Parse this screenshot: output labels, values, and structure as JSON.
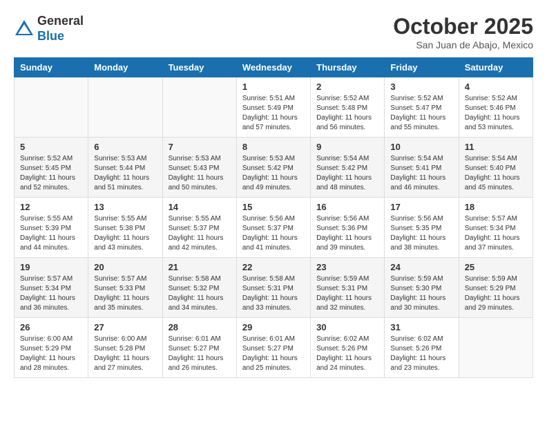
{
  "header": {
    "logo_general": "General",
    "logo_blue": "Blue",
    "month_title": "October 2025",
    "location": "San Juan de Abajo, Mexico"
  },
  "days_of_week": [
    "Sunday",
    "Monday",
    "Tuesday",
    "Wednesday",
    "Thursday",
    "Friday",
    "Saturday"
  ],
  "weeks": [
    [
      {
        "day": "",
        "sunrise": "",
        "sunset": "",
        "daylight": ""
      },
      {
        "day": "",
        "sunrise": "",
        "sunset": "",
        "daylight": ""
      },
      {
        "day": "",
        "sunrise": "",
        "sunset": "",
        "daylight": ""
      },
      {
        "day": "1",
        "sunrise": "Sunrise: 5:51 AM",
        "sunset": "Sunset: 5:49 PM",
        "daylight": "Daylight: 11 hours and 57 minutes."
      },
      {
        "day": "2",
        "sunrise": "Sunrise: 5:52 AM",
        "sunset": "Sunset: 5:48 PM",
        "daylight": "Daylight: 11 hours and 56 minutes."
      },
      {
        "day": "3",
        "sunrise": "Sunrise: 5:52 AM",
        "sunset": "Sunset: 5:47 PM",
        "daylight": "Daylight: 11 hours and 55 minutes."
      },
      {
        "day": "4",
        "sunrise": "Sunrise: 5:52 AM",
        "sunset": "Sunset: 5:46 PM",
        "daylight": "Daylight: 11 hours and 53 minutes."
      }
    ],
    [
      {
        "day": "5",
        "sunrise": "Sunrise: 5:52 AM",
        "sunset": "Sunset: 5:45 PM",
        "daylight": "Daylight: 11 hours and 52 minutes."
      },
      {
        "day": "6",
        "sunrise": "Sunrise: 5:53 AM",
        "sunset": "Sunset: 5:44 PM",
        "daylight": "Daylight: 11 hours and 51 minutes."
      },
      {
        "day": "7",
        "sunrise": "Sunrise: 5:53 AM",
        "sunset": "Sunset: 5:43 PM",
        "daylight": "Daylight: 11 hours and 50 minutes."
      },
      {
        "day": "8",
        "sunrise": "Sunrise: 5:53 AM",
        "sunset": "Sunset: 5:42 PM",
        "daylight": "Daylight: 11 hours and 49 minutes."
      },
      {
        "day": "9",
        "sunrise": "Sunrise: 5:54 AM",
        "sunset": "Sunset: 5:42 PM",
        "daylight": "Daylight: 11 hours and 48 minutes."
      },
      {
        "day": "10",
        "sunrise": "Sunrise: 5:54 AM",
        "sunset": "Sunset: 5:41 PM",
        "daylight": "Daylight: 11 hours and 46 minutes."
      },
      {
        "day": "11",
        "sunrise": "Sunrise: 5:54 AM",
        "sunset": "Sunset: 5:40 PM",
        "daylight": "Daylight: 11 hours and 45 minutes."
      }
    ],
    [
      {
        "day": "12",
        "sunrise": "Sunrise: 5:55 AM",
        "sunset": "Sunset: 5:39 PM",
        "daylight": "Daylight: 11 hours and 44 minutes."
      },
      {
        "day": "13",
        "sunrise": "Sunrise: 5:55 AM",
        "sunset": "Sunset: 5:38 PM",
        "daylight": "Daylight: 11 hours and 43 minutes."
      },
      {
        "day": "14",
        "sunrise": "Sunrise: 5:55 AM",
        "sunset": "Sunset: 5:37 PM",
        "daylight": "Daylight: 11 hours and 42 minutes."
      },
      {
        "day": "15",
        "sunrise": "Sunrise: 5:56 AM",
        "sunset": "Sunset: 5:37 PM",
        "daylight": "Daylight: 11 hours and 41 minutes."
      },
      {
        "day": "16",
        "sunrise": "Sunrise: 5:56 AM",
        "sunset": "Sunset: 5:36 PM",
        "daylight": "Daylight: 11 hours and 39 minutes."
      },
      {
        "day": "17",
        "sunrise": "Sunrise: 5:56 AM",
        "sunset": "Sunset: 5:35 PM",
        "daylight": "Daylight: 11 hours and 38 minutes."
      },
      {
        "day": "18",
        "sunrise": "Sunrise: 5:57 AM",
        "sunset": "Sunset: 5:34 PM",
        "daylight": "Daylight: 11 hours and 37 minutes."
      }
    ],
    [
      {
        "day": "19",
        "sunrise": "Sunrise: 5:57 AM",
        "sunset": "Sunset: 5:34 PM",
        "daylight": "Daylight: 11 hours and 36 minutes."
      },
      {
        "day": "20",
        "sunrise": "Sunrise: 5:57 AM",
        "sunset": "Sunset: 5:33 PM",
        "daylight": "Daylight: 11 hours and 35 minutes."
      },
      {
        "day": "21",
        "sunrise": "Sunrise: 5:58 AM",
        "sunset": "Sunset: 5:32 PM",
        "daylight": "Daylight: 11 hours and 34 minutes."
      },
      {
        "day": "22",
        "sunrise": "Sunrise: 5:58 AM",
        "sunset": "Sunset: 5:31 PM",
        "daylight": "Daylight: 11 hours and 33 minutes."
      },
      {
        "day": "23",
        "sunrise": "Sunrise: 5:59 AM",
        "sunset": "Sunset: 5:31 PM",
        "daylight": "Daylight: 11 hours and 32 minutes."
      },
      {
        "day": "24",
        "sunrise": "Sunrise: 5:59 AM",
        "sunset": "Sunset: 5:30 PM",
        "daylight": "Daylight: 11 hours and 30 minutes."
      },
      {
        "day": "25",
        "sunrise": "Sunrise: 5:59 AM",
        "sunset": "Sunset: 5:29 PM",
        "daylight": "Daylight: 11 hours and 29 minutes."
      }
    ],
    [
      {
        "day": "26",
        "sunrise": "Sunrise: 6:00 AM",
        "sunset": "Sunset: 5:29 PM",
        "daylight": "Daylight: 11 hours and 28 minutes."
      },
      {
        "day": "27",
        "sunrise": "Sunrise: 6:00 AM",
        "sunset": "Sunset: 5:28 PM",
        "daylight": "Daylight: 11 hours and 27 minutes."
      },
      {
        "day": "28",
        "sunrise": "Sunrise: 6:01 AM",
        "sunset": "Sunset: 5:27 PM",
        "daylight": "Daylight: 11 hours and 26 minutes."
      },
      {
        "day": "29",
        "sunrise": "Sunrise: 6:01 AM",
        "sunset": "Sunset: 5:27 PM",
        "daylight": "Daylight: 11 hours and 25 minutes."
      },
      {
        "day": "30",
        "sunrise": "Sunrise: 6:02 AM",
        "sunset": "Sunset: 5:26 PM",
        "daylight": "Daylight: 11 hours and 24 minutes."
      },
      {
        "day": "31",
        "sunrise": "Sunrise: 6:02 AM",
        "sunset": "Sunset: 5:26 PM",
        "daylight": "Daylight: 11 hours and 23 minutes."
      },
      {
        "day": "",
        "sunrise": "",
        "sunset": "",
        "daylight": ""
      }
    ]
  ]
}
